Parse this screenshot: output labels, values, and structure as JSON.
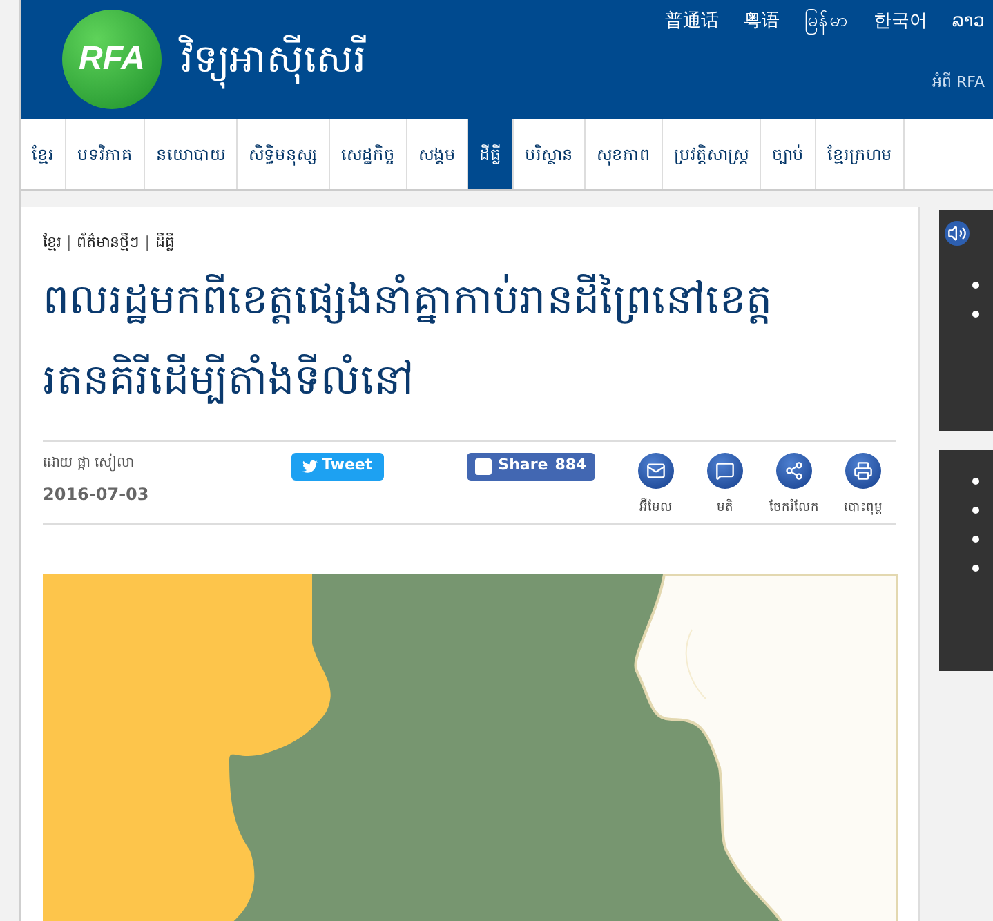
{
  "header": {
    "site_name": "វិទ្យុអាស៊ីសេរី",
    "logo": "RFA",
    "languages": [
      "普通话",
      "粤语",
      "မြန်မာ",
      "한국어",
      "ລາວ"
    ],
    "about_link": "អំពី RFA"
  },
  "nav": [
    {
      "label": "ខ្មែរ",
      "selected": false
    },
    {
      "label": "បទវិភាគ",
      "selected": false
    },
    {
      "label": "នយោបាយ",
      "selected": false
    },
    {
      "label": "សិទ្ធិមនុស្ស",
      "selected": false
    },
    {
      "label": "សេដ្ឋកិច្ច",
      "selected": false
    },
    {
      "label": "សង្គម",
      "selected": false
    },
    {
      "label": "ដីធ្លី",
      "selected": true
    },
    {
      "label": "បរិស្ថាន",
      "selected": false
    },
    {
      "label": "សុខភាព",
      "selected": false
    },
    {
      "label": "ប្រវត្តិសាស្ត្រ",
      "selected": false
    },
    {
      "label": "ច្បាប់",
      "selected": false
    },
    {
      "label": "ខ្មែរក្រហម",
      "selected": false
    }
  ],
  "breadcrumb": {
    "separator": "|",
    "items": [
      "ខ្មែរ",
      "ព័ត៌មានថ្មីៗ",
      "ដីធ្លី"
    ]
  },
  "article": {
    "title": "ពលរដ្ឋមកពីខេត្តផ្សេងនាំគ្នាកាប់រានដីព្រៃនៅខេត្តរតនគិរីដើម្បីតាំងទីលំនៅ",
    "byline": "ដោយ ផ្កា សៀលា",
    "date": "2016-07-03",
    "tweet": "Tweet",
    "share": "Share",
    "share_count": "884",
    "tools": [
      {
        "kind": "email",
        "label": "អ៊ីមែល"
      },
      {
        "kind": "comment",
        "label": "មតិ"
      },
      {
        "kind": "share",
        "label": "ចែករំលែក"
      },
      {
        "kind": "print",
        "label": "បោះពុម្ព"
      }
    ]
  }
}
